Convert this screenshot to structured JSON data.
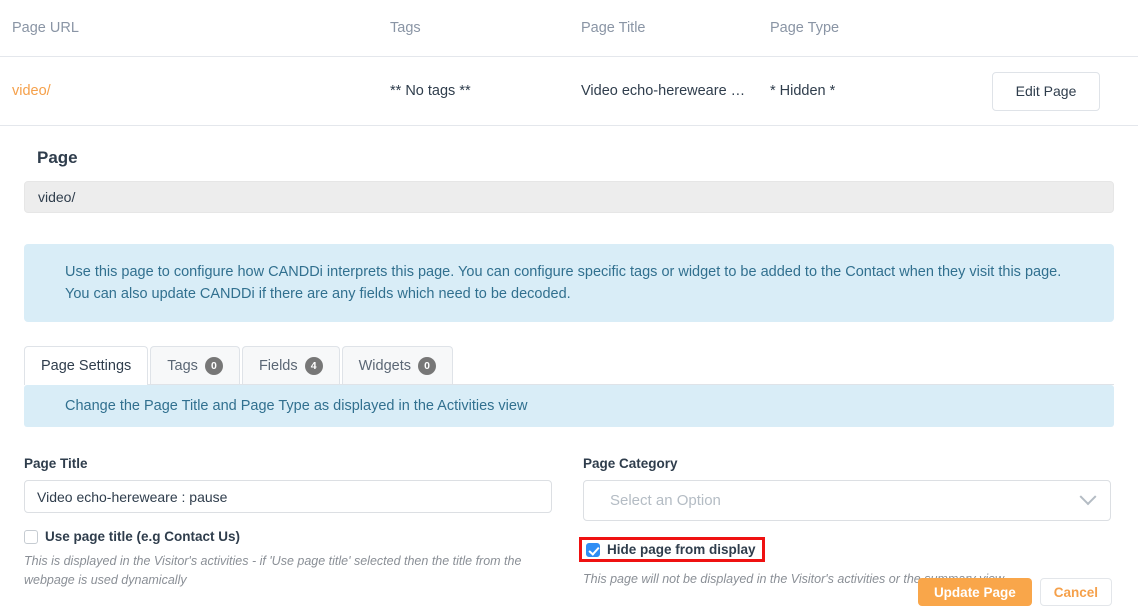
{
  "table": {
    "headers": [
      "Page URL",
      "Tags",
      "Page Title",
      "Page Type"
    ],
    "row": {
      "url": "video/",
      "tags": "** No tags **",
      "title": "Video echo-hereweare …",
      "type": "* Hidden *",
      "edit_label": "Edit Page"
    }
  },
  "section": {
    "title": "Page",
    "url_value": "video/"
  },
  "alerts": {
    "main": "Use this page to configure how CANDDi interprets this page. You can configure specific tags or widget to be added to the Contact when they visit this page. You can also update CANDDi if there are any fields which need to be decoded.",
    "sub": "Change the Page Title and Page Type as displayed in the Activities view"
  },
  "tabs": [
    {
      "label": "Page Settings",
      "badge": null,
      "active": true
    },
    {
      "label": "Tags",
      "badge": "0",
      "active": false
    },
    {
      "label": "Fields",
      "badge": "4",
      "active": false
    },
    {
      "label": "Widgets",
      "badge": "0",
      "active": false
    }
  ],
  "form": {
    "page_title": {
      "label": "Page Title",
      "value": "Video echo-hereweare : pause",
      "placeholder": "Page Title"
    },
    "page_category": {
      "label": "Page Category",
      "value": "Select an Option"
    },
    "use_page_title": {
      "label": "Use page title (e.g Contact Us)",
      "checked": false,
      "help": "This is displayed in the Visitor's activities - if 'Use page title' selected then the title from the webpage is used dynamically"
    },
    "hide_page": {
      "label": "Hide page from display",
      "checked": true,
      "help": "This page will not be displayed in the Visitor's activities or the summary view"
    }
  },
  "footer": {
    "update_label": "Update Page",
    "cancel_label": "Cancel"
  },
  "colors": {
    "accent_orange": "#f9a64a",
    "link_orange": "#f5a04a",
    "info_bg": "#d9edf7",
    "info_text": "#31708f",
    "badge_bg": "#777777",
    "checkbox_blue": "#2f8ef4",
    "highlight_red": "#ef1111"
  }
}
